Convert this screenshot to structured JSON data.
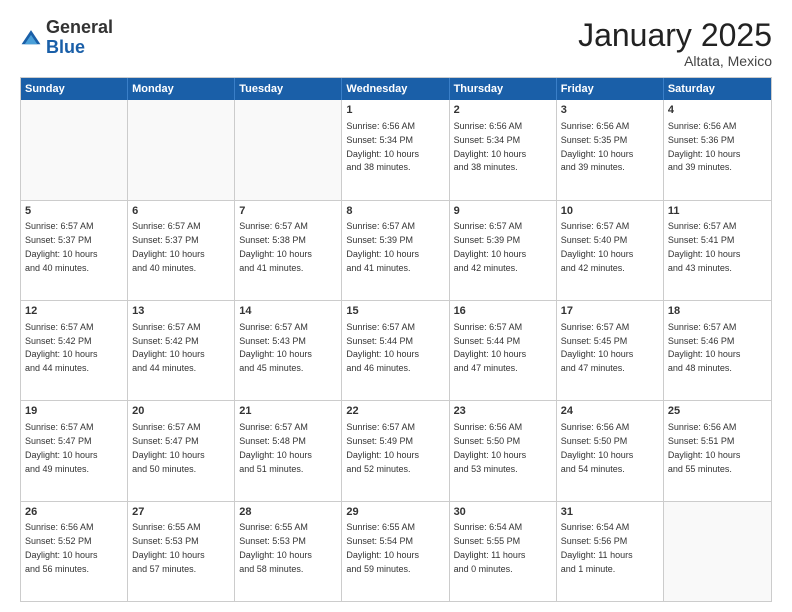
{
  "header": {
    "logo": {
      "general": "General",
      "blue": "Blue"
    },
    "month": "January 2025",
    "location": "Altata, Mexico"
  },
  "weekdays": [
    "Sunday",
    "Monday",
    "Tuesday",
    "Wednesday",
    "Thursday",
    "Friday",
    "Saturday"
  ],
  "rows": [
    [
      {
        "day": "",
        "text": "",
        "empty": true
      },
      {
        "day": "",
        "text": "",
        "empty": true
      },
      {
        "day": "",
        "text": "",
        "empty": true
      },
      {
        "day": "1",
        "text": "Sunrise: 6:56 AM\nSunset: 5:34 PM\nDaylight: 10 hours\nand 38 minutes.",
        "empty": false
      },
      {
        "day": "2",
        "text": "Sunrise: 6:56 AM\nSunset: 5:34 PM\nDaylight: 10 hours\nand 38 minutes.",
        "empty": false
      },
      {
        "day": "3",
        "text": "Sunrise: 6:56 AM\nSunset: 5:35 PM\nDaylight: 10 hours\nand 39 minutes.",
        "empty": false
      },
      {
        "day": "4",
        "text": "Sunrise: 6:56 AM\nSunset: 5:36 PM\nDaylight: 10 hours\nand 39 minutes.",
        "empty": false
      }
    ],
    [
      {
        "day": "5",
        "text": "Sunrise: 6:57 AM\nSunset: 5:37 PM\nDaylight: 10 hours\nand 40 minutes.",
        "empty": false
      },
      {
        "day": "6",
        "text": "Sunrise: 6:57 AM\nSunset: 5:37 PM\nDaylight: 10 hours\nand 40 minutes.",
        "empty": false
      },
      {
        "day": "7",
        "text": "Sunrise: 6:57 AM\nSunset: 5:38 PM\nDaylight: 10 hours\nand 41 minutes.",
        "empty": false
      },
      {
        "day": "8",
        "text": "Sunrise: 6:57 AM\nSunset: 5:39 PM\nDaylight: 10 hours\nand 41 minutes.",
        "empty": false
      },
      {
        "day": "9",
        "text": "Sunrise: 6:57 AM\nSunset: 5:39 PM\nDaylight: 10 hours\nand 42 minutes.",
        "empty": false
      },
      {
        "day": "10",
        "text": "Sunrise: 6:57 AM\nSunset: 5:40 PM\nDaylight: 10 hours\nand 42 minutes.",
        "empty": false
      },
      {
        "day": "11",
        "text": "Sunrise: 6:57 AM\nSunset: 5:41 PM\nDaylight: 10 hours\nand 43 minutes.",
        "empty": false
      }
    ],
    [
      {
        "day": "12",
        "text": "Sunrise: 6:57 AM\nSunset: 5:42 PM\nDaylight: 10 hours\nand 44 minutes.",
        "empty": false
      },
      {
        "day": "13",
        "text": "Sunrise: 6:57 AM\nSunset: 5:42 PM\nDaylight: 10 hours\nand 44 minutes.",
        "empty": false
      },
      {
        "day": "14",
        "text": "Sunrise: 6:57 AM\nSunset: 5:43 PM\nDaylight: 10 hours\nand 45 minutes.",
        "empty": false
      },
      {
        "day": "15",
        "text": "Sunrise: 6:57 AM\nSunset: 5:44 PM\nDaylight: 10 hours\nand 46 minutes.",
        "empty": false
      },
      {
        "day": "16",
        "text": "Sunrise: 6:57 AM\nSunset: 5:44 PM\nDaylight: 10 hours\nand 47 minutes.",
        "empty": false
      },
      {
        "day": "17",
        "text": "Sunrise: 6:57 AM\nSunset: 5:45 PM\nDaylight: 10 hours\nand 47 minutes.",
        "empty": false
      },
      {
        "day": "18",
        "text": "Sunrise: 6:57 AM\nSunset: 5:46 PM\nDaylight: 10 hours\nand 48 minutes.",
        "empty": false
      }
    ],
    [
      {
        "day": "19",
        "text": "Sunrise: 6:57 AM\nSunset: 5:47 PM\nDaylight: 10 hours\nand 49 minutes.",
        "empty": false
      },
      {
        "day": "20",
        "text": "Sunrise: 6:57 AM\nSunset: 5:47 PM\nDaylight: 10 hours\nand 50 minutes.",
        "empty": false
      },
      {
        "day": "21",
        "text": "Sunrise: 6:57 AM\nSunset: 5:48 PM\nDaylight: 10 hours\nand 51 minutes.",
        "empty": false
      },
      {
        "day": "22",
        "text": "Sunrise: 6:57 AM\nSunset: 5:49 PM\nDaylight: 10 hours\nand 52 minutes.",
        "empty": false
      },
      {
        "day": "23",
        "text": "Sunrise: 6:56 AM\nSunset: 5:50 PM\nDaylight: 10 hours\nand 53 minutes.",
        "empty": false
      },
      {
        "day": "24",
        "text": "Sunrise: 6:56 AM\nSunset: 5:50 PM\nDaylight: 10 hours\nand 54 minutes.",
        "empty": false
      },
      {
        "day": "25",
        "text": "Sunrise: 6:56 AM\nSunset: 5:51 PM\nDaylight: 10 hours\nand 55 minutes.",
        "empty": false
      }
    ],
    [
      {
        "day": "26",
        "text": "Sunrise: 6:56 AM\nSunset: 5:52 PM\nDaylight: 10 hours\nand 56 minutes.",
        "empty": false
      },
      {
        "day": "27",
        "text": "Sunrise: 6:55 AM\nSunset: 5:53 PM\nDaylight: 10 hours\nand 57 minutes.",
        "empty": false
      },
      {
        "day": "28",
        "text": "Sunrise: 6:55 AM\nSunset: 5:53 PM\nDaylight: 10 hours\nand 58 minutes.",
        "empty": false
      },
      {
        "day": "29",
        "text": "Sunrise: 6:55 AM\nSunset: 5:54 PM\nDaylight: 10 hours\nand 59 minutes.",
        "empty": false
      },
      {
        "day": "30",
        "text": "Sunrise: 6:54 AM\nSunset: 5:55 PM\nDaylight: 11 hours\nand 0 minutes.",
        "empty": false
      },
      {
        "day": "31",
        "text": "Sunrise: 6:54 AM\nSunset: 5:56 PM\nDaylight: 11 hours\nand 1 minute.",
        "empty": false
      },
      {
        "day": "",
        "text": "",
        "empty": true
      }
    ]
  ]
}
